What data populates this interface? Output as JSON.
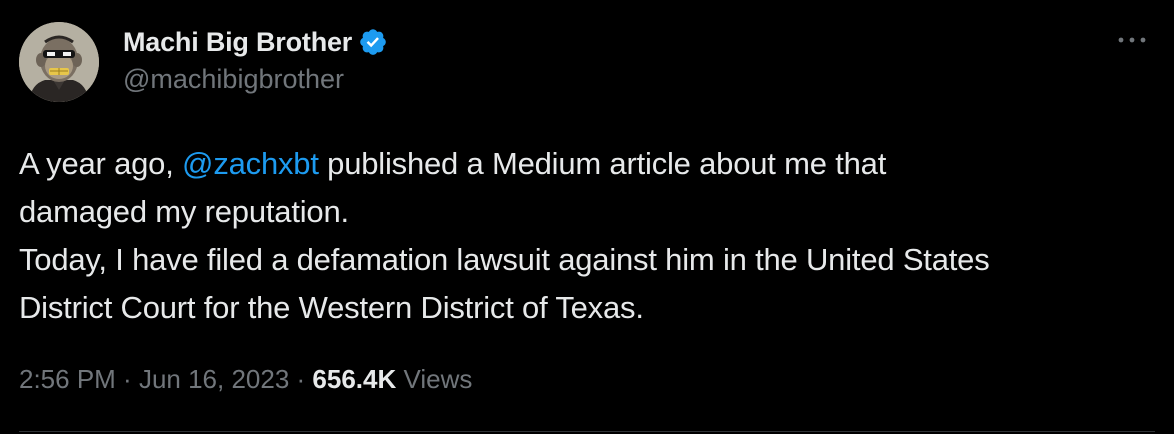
{
  "author": {
    "display_name": "Machi Big Brother",
    "handle": "@machibigbrother",
    "verified": true,
    "avatar_icon": "bored-ape-avatar-icon",
    "verified_icon": "verified-badge-icon"
  },
  "menu": {
    "more_label": "···"
  },
  "tweet": {
    "line1_before": "A year ago, ",
    "mention": "@zachxbt",
    "line1_after": " published a Medium article about me that",
    "line2": "damaged my reputation.",
    "line3": "Today, I have filed a defamation lawsuit against him in the United States",
    "line4": "District Court for the Western District of Texas."
  },
  "meta": {
    "time": "2:56 PM",
    "separator": " · ",
    "date": "Jun 16, 2023",
    "views_count": "656.4K",
    "views_label": "Views"
  },
  "colors": {
    "background": "#000000",
    "text": "#e7e9ea",
    "secondary": "#71767b",
    "accent": "#1d9bf0"
  }
}
